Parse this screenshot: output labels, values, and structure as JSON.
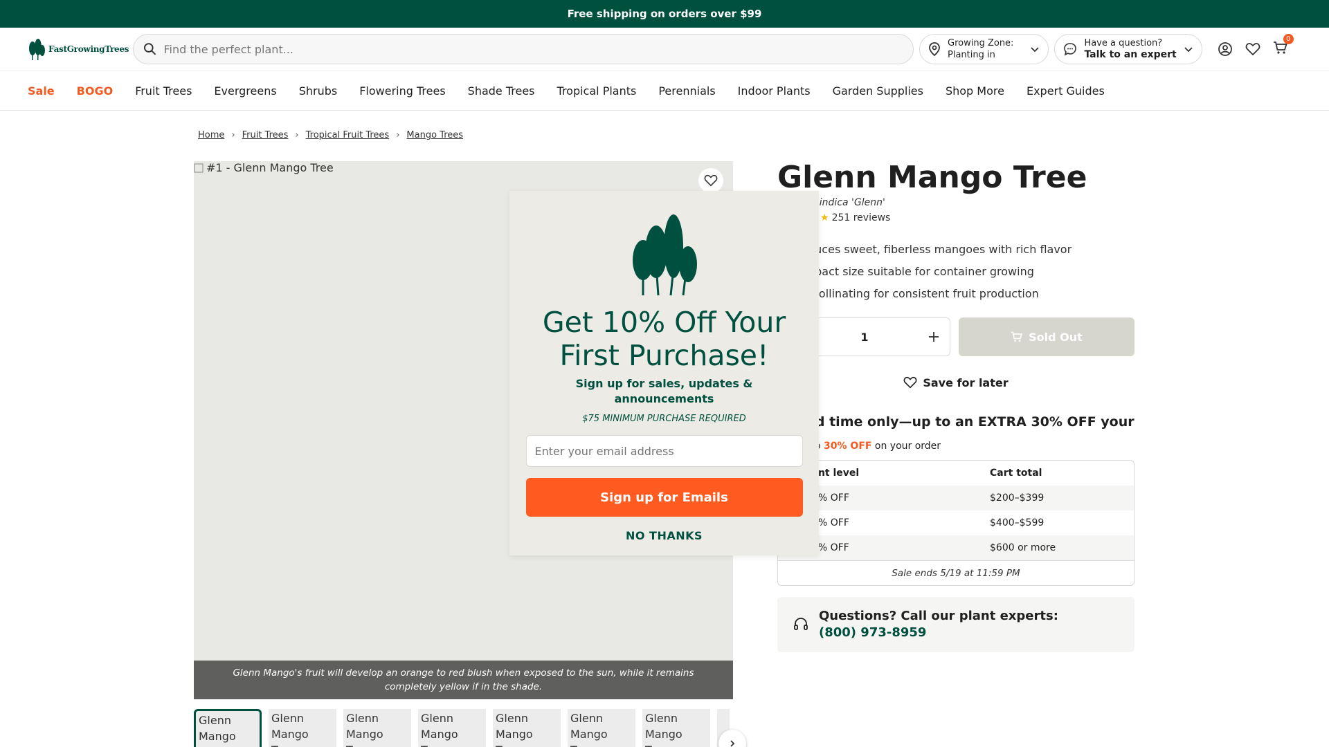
{
  "promo": {
    "text": "Free shipping on orders over $99"
  },
  "header": {
    "logo_text": "FastGrowingTrees",
    "search_placeholder": "Find the perfect plant...",
    "zone": {
      "line1": "Growing Zone:",
      "line2": "Planting in"
    },
    "expert": {
      "line1": "Have a question?",
      "line2": "Talk to an expert"
    },
    "cart_count": "0"
  },
  "nav": {
    "items": [
      "Sale",
      "BOGO",
      "Fruit Trees",
      "Evergreens",
      "Shrubs",
      "Flowering Trees",
      "Shade Trees",
      "Tropical Plants",
      "Perennials",
      "Indoor Plants",
      "Garden Supplies",
      "Shop More",
      "Expert Guides"
    ]
  },
  "breadcrumb": [
    "Home",
    "Fruit Trees",
    "Tropical Fruit Trees",
    "Mango Trees"
  ],
  "gallery": {
    "main_alt": "#1 - Glenn Mango Tree",
    "caption": "Glenn Mango's fruit will develop an orange to red blush when exposed to the sun, while it remains completely yellow if in the shade.",
    "thumb_alt": "Glenn Mango Tree"
  },
  "product": {
    "title": "Glenn Mango Tree",
    "botanical": "ra indica 'Glenn'",
    "reviews": "251 reviews",
    "bullets": [
      "duces sweet, fiberless mangoes with rich flavor",
      "npact size suitable for container growing",
      "-pollinating for consistent fruit production"
    ],
    "qty": "1",
    "sold_out": "Sold Out",
    "save_later": "Save for later"
  },
  "sale": {
    "headline": "ed time only—up to an EXTRA 30% OFF your",
    "sub_prefix": "o",
    "sub_bold": "30% OFF",
    "sub_suffix": "on your order",
    "col1": "unt level",
    "col2": "Cart total",
    "tiers": [
      {
        "level": "% OFF",
        "total": "$200–$399"
      },
      {
        "level": "% OFF",
        "total": "$400–$599"
      },
      {
        "level": "30% OFF",
        "total": "$600 or more"
      }
    ],
    "ends": "Sale ends 5/19 at 11:59 PM"
  },
  "questions": {
    "label": "Questions? Call our plant experts:",
    "phone": "(800) 973-8959"
  },
  "modal": {
    "headline": "Get 10% Off Your First Purchase!",
    "sub": "Sign up for sales, updates & announcements",
    "min": "$75 MINIMUM PURCHASE REQUIRED",
    "email_placeholder": "Enter your email address",
    "signup": "Sign up for Emails",
    "no_thanks": "NO THANKS"
  },
  "colors": {
    "brand": "#00503f",
    "accent": "#f25a1f",
    "signup": "#ff5a1f"
  }
}
